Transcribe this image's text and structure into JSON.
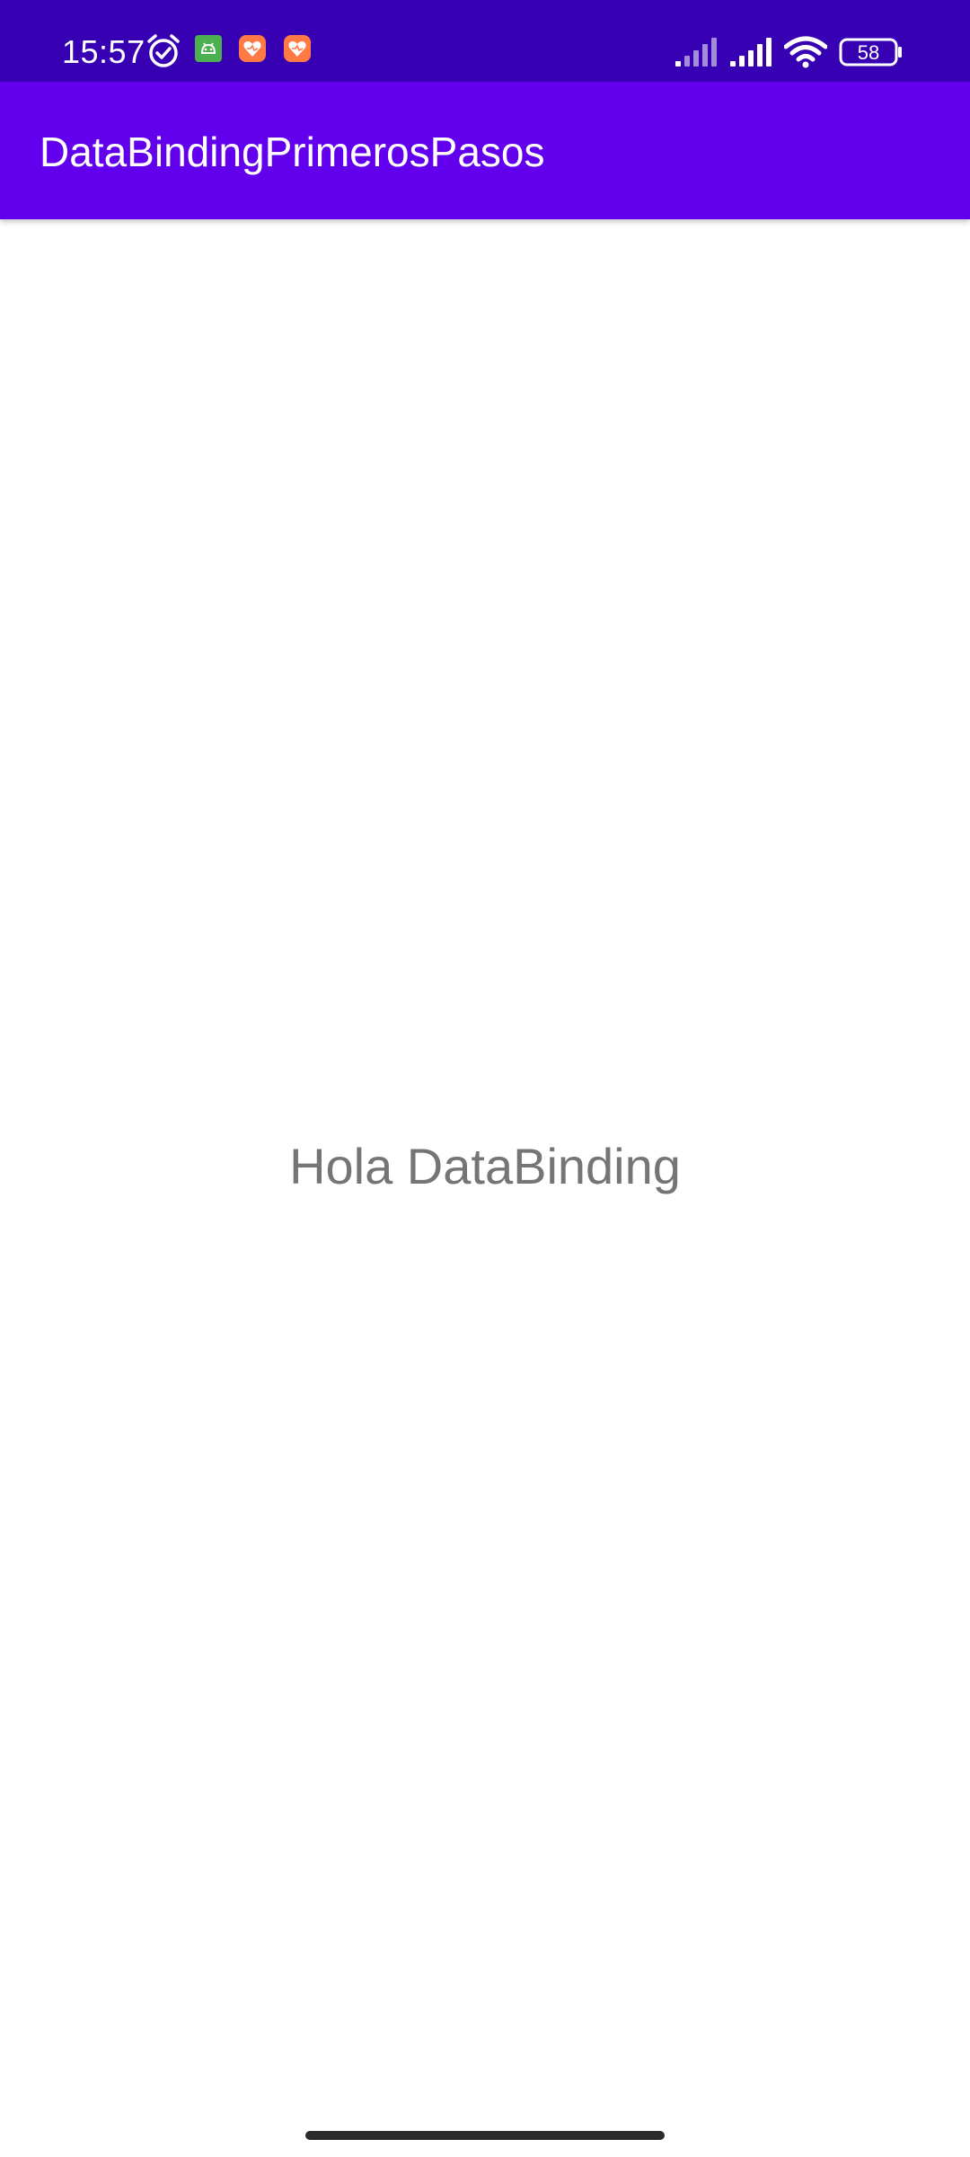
{
  "status_bar": {
    "time": "15:57",
    "battery_level": "58",
    "background_color": "#3700b3",
    "icons": [
      "alarm-icon",
      "android-app-icon",
      "heart-app-icon",
      "heart-app-icon",
      "signal-weak-icon",
      "signal-strong-icon",
      "wifi-icon",
      "battery-icon"
    ]
  },
  "app_bar": {
    "title": "DataBindingPrimerosPasos",
    "background_color": "#6200ee"
  },
  "main": {
    "text": "Hola DataBinding"
  }
}
